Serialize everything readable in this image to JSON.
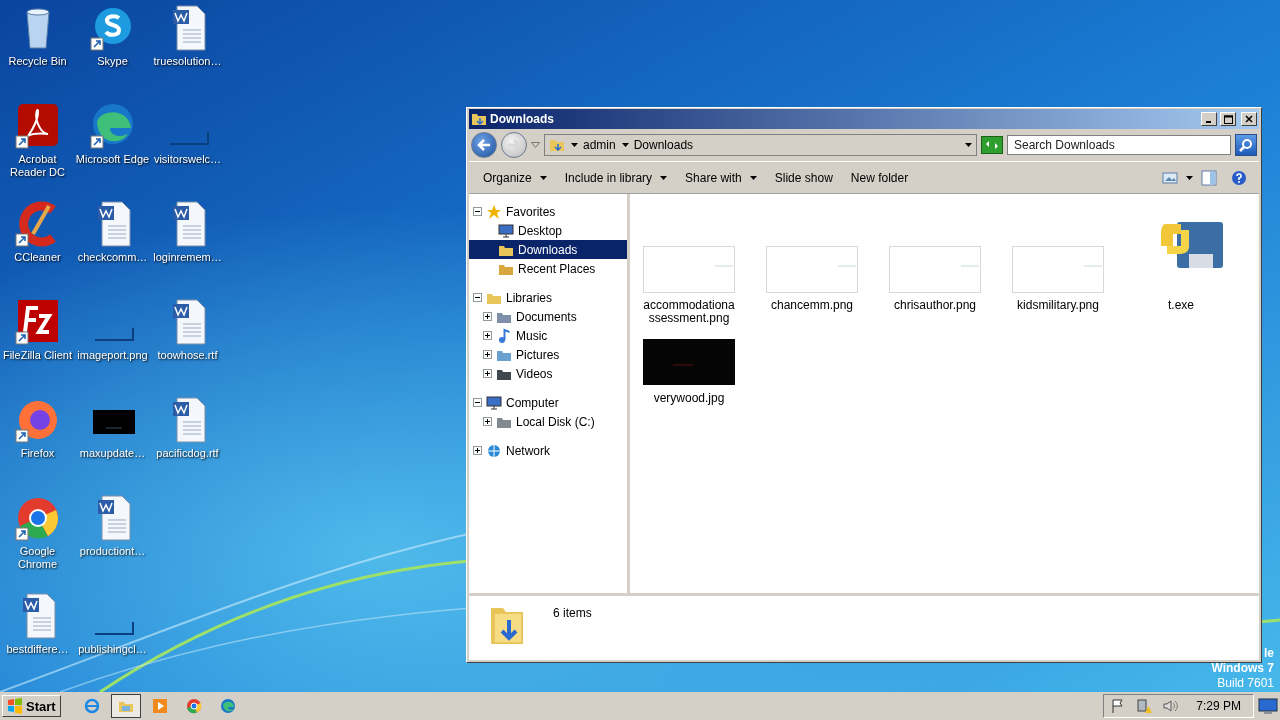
{
  "desktop_icons": [
    {
      "label": "Recycle Bin",
      "kind": "recycle",
      "shortcut": false
    },
    {
      "label": "Acrobat Reader DC",
      "kind": "acrobat",
      "shortcut": true
    },
    {
      "label": "CCleaner",
      "kind": "ccleaner",
      "shortcut": true
    },
    {
      "label": "FileZilla Client",
      "kind": "filezilla",
      "shortcut": true
    },
    {
      "label": "Firefox",
      "kind": "firefox",
      "shortcut": true
    },
    {
      "label": "Google Chrome",
      "kind": "chrome",
      "shortcut": true
    },
    {
      "label": "bestdiffere…",
      "kind": "word",
      "shortcut": false
    },
    {
      "label": "Skype",
      "kind": "skype",
      "shortcut": true
    },
    {
      "label": "Microsoft Edge",
      "kind": "edge",
      "shortcut": true
    },
    {
      "label": "checkcomm…",
      "kind": "word",
      "shortcut": false
    },
    {
      "label": "imageport.png",
      "kind": "blank",
      "shortcut": false
    },
    {
      "label": "maxupdate…",
      "kind": "dark",
      "shortcut": false
    },
    {
      "label": "productiont…",
      "kind": "word",
      "shortcut": false
    },
    {
      "label": "publishingcl…",
      "kind": "blank",
      "shortcut": false
    },
    {
      "label": "truesolution…",
      "kind": "word",
      "shortcut": false
    },
    {
      "label": "visitorswelc…",
      "kind": "blank",
      "shortcut": false
    },
    {
      "label": "loginremem…",
      "kind": "word",
      "shortcut": false
    },
    {
      "label": "toowhose.rtf",
      "kind": "word",
      "shortcut": false
    },
    {
      "label": "pacificdog.rtf",
      "kind": "word",
      "shortcut": false
    }
  ],
  "explorer": {
    "title": "Downloads",
    "breadcrumb": [
      "admin",
      "Downloads"
    ],
    "search": {
      "placeholder": "Search Downloads"
    },
    "commands": [
      {
        "label": "Organize",
        "menu": true
      },
      {
        "label": "Include in library",
        "menu": true
      },
      {
        "label": "Share with",
        "menu": true
      },
      {
        "label": "Slide show",
        "menu": false
      },
      {
        "label": "New folder",
        "menu": false
      }
    ],
    "nav": [
      {
        "label": "Favorites",
        "kind": "star",
        "expanded": true,
        "selected": false,
        "children": [
          {
            "label": "Desktop",
            "kind": "desktop",
            "selected": false
          },
          {
            "label": "Downloads",
            "kind": "downloads",
            "selected": true
          },
          {
            "label": "Recent Places",
            "kind": "recent",
            "selected": false
          }
        ]
      },
      {
        "label": "Libraries",
        "kind": "library",
        "expanded": true,
        "selected": false,
        "children": [
          {
            "label": "Documents",
            "kind": "documents",
            "expanded": false,
            "selected": false
          },
          {
            "label": "Music",
            "kind": "music",
            "expanded": false,
            "selected": false
          },
          {
            "label": "Pictures",
            "kind": "pictures",
            "expanded": false,
            "selected": false
          },
          {
            "label": "Videos",
            "kind": "videos",
            "expanded": false,
            "selected": false
          }
        ]
      },
      {
        "label": "Computer",
        "kind": "computer",
        "expanded": true,
        "selected": false,
        "children": [
          {
            "label": "Local Disk (C:)",
            "kind": "disk",
            "expanded": false,
            "selected": false
          }
        ]
      },
      {
        "label": "Network",
        "kind": "network",
        "expanded": false,
        "selected": false
      }
    ],
    "files": [
      {
        "name": "accommodationassessment.png",
        "kind": "light"
      },
      {
        "name": "chancemm.png",
        "kind": "light"
      },
      {
        "name": "chrisauthor.png",
        "kind": "light"
      },
      {
        "name": "kidsmilitary.png",
        "kind": "light"
      },
      {
        "name": "t.exe",
        "kind": "python"
      },
      {
        "name": "verywood.jpg",
        "kind": "dark"
      }
    ],
    "status": "6 items"
  },
  "watermark_lines": [
    "le",
    "Windows 7",
    "Build 7601"
  ],
  "taskbar": {
    "start": "Start",
    "apps": [
      {
        "kind": "ie",
        "active": false
      },
      {
        "kind": "explorer",
        "active": true
      },
      {
        "kind": "media",
        "active": false
      },
      {
        "kind": "chrome",
        "active": false
      },
      {
        "kind": "edge",
        "active": false
      }
    ],
    "clock": "7:29 PM"
  }
}
